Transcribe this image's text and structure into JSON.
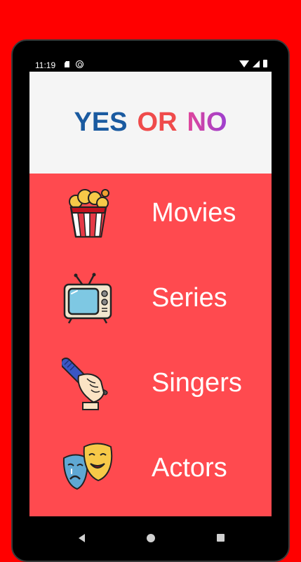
{
  "status_bar": {
    "time": "11:19",
    "icons": [
      "sd-card-icon",
      "sync-icon",
      "wifi-icon",
      "signal-icon",
      "battery-icon"
    ]
  },
  "header": {
    "title_parts": [
      "YES",
      "OR",
      "NO"
    ]
  },
  "menu": {
    "items": [
      {
        "label": "Movies",
        "icon": "popcorn-icon"
      },
      {
        "label": "Series",
        "icon": "tv-icon"
      },
      {
        "label": "Singers",
        "icon": "microphone-icon"
      },
      {
        "label": "Actors",
        "icon": "theater-masks-icon"
      }
    ]
  },
  "navigation": {
    "buttons": [
      "back-button",
      "home-button",
      "recents-button"
    ]
  },
  "colors": {
    "page_background": "#ff0000",
    "screen_background": "#ff4a4f",
    "header_background": "#f5f5f5",
    "title_yes": "#1a5aa0",
    "title_or": "#ef4b4b",
    "title_no_start": "#e0459a",
    "title_no_end": "#9c3fd0"
  }
}
